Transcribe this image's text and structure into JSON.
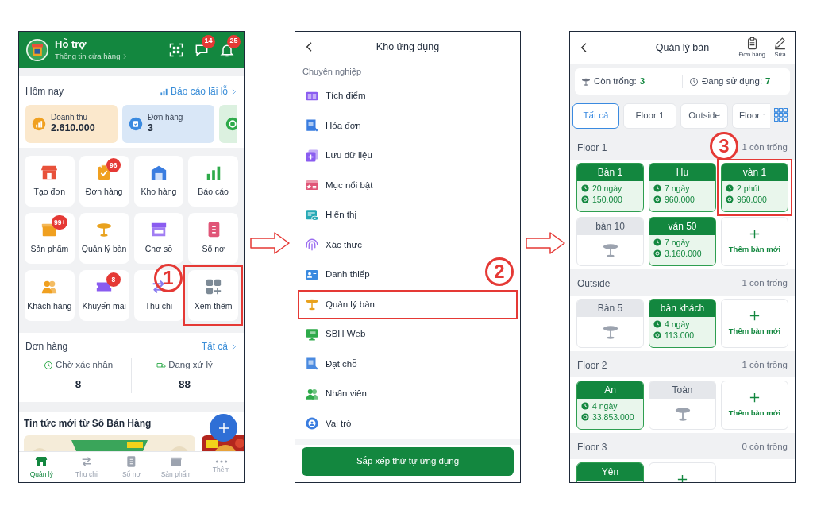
{
  "home": {
    "step": "1",
    "header": {
      "title": "Hỗ trợ",
      "subtitle": "Thông tin cửa hàng",
      "actions": [
        {
          "kind": "qr"
        },
        {
          "kind": "chat",
          "badge": "14"
        },
        {
          "kind": "bell",
          "badge": "25"
        }
      ]
    },
    "today": {
      "title": "Hôm nay",
      "link": "Báo cáo lãi lỗ",
      "cards": [
        {
          "kind": "revenue",
          "label": "Doanh thu",
          "value": "2.610.000"
        },
        {
          "kind": "orders",
          "label": "Đơn hàng",
          "value": "3"
        },
        {
          "kind": "cash"
        }
      ]
    },
    "tiles": [
      {
        "kind": "create",
        "label": "Tạo đơn",
        "highlighted": false
      },
      {
        "kind": "orders",
        "label": "Đơn hàng",
        "badge": "96",
        "highlighted": false
      },
      {
        "kind": "warehouse",
        "label": "Kho hàng",
        "highlighted": false
      },
      {
        "kind": "report",
        "label": "Báo cáo",
        "highlighted": false
      },
      {
        "kind": "product",
        "label": "Sản phẩm",
        "badge": "99+",
        "highlighted": false
      },
      {
        "kind": "table",
        "label": "Quản lý bàn",
        "highlighted": false
      },
      {
        "kind": "market",
        "label": "Chợ số",
        "highlighted": false
      },
      {
        "kind": "debt",
        "label": "Sổ nợ",
        "highlighted": false
      },
      {
        "kind": "customer",
        "label": "Khách hàng",
        "highlighted": false
      },
      {
        "kind": "promo",
        "label": "Khuyến mãi",
        "badge": "8",
        "highlighted": false
      },
      {
        "kind": "cashflow",
        "label": "Thu chi",
        "highlighted": false
      },
      {
        "kind": "more",
        "label": "Xem thêm",
        "highlighted": true
      }
    ],
    "orders": {
      "title": "Đơn hàng",
      "link": "Tất cả",
      "stats": [
        {
          "kind": "pending",
          "label": "Chờ xác nhận",
          "value": "8"
        },
        {
          "kind": "processing",
          "label": "Đang xử lý",
          "value": "88"
        }
      ]
    },
    "news": {
      "title": "Tin tức mới từ Số Bán Hàng"
    },
    "nav": [
      {
        "kind": "home",
        "label": "Quản lý",
        "selected": true
      },
      {
        "kind": "cashflow",
        "label": "Thu chi",
        "selected": false
      },
      {
        "kind": "debt",
        "label": "Sổ nợ",
        "selected": false
      },
      {
        "kind": "product",
        "label": "Sản phẩm",
        "selected": false
      },
      {
        "kind": "more",
        "label": "Thêm",
        "selected": false
      }
    ]
  },
  "app_store": {
    "step": "2",
    "title": "Kho ứng dụng",
    "section": "Chuyên nghiệp",
    "items": [
      {
        "kind": "points",
        "label": "Tích điểm",
        "highlighted": false
      },
      {
        "kind": "invoice",
        "label": "Hóa đơn",
        "highlighted": false
      },
      {
        "kind": "backup",
        "label": "Lưu dữ liệu",
        "highlighted": false
      },
      {
        "kind": "featured",
        "label": "Mục nổi bật",
        "highlighted": false
      },
      {
        "kind": "display",
        "label": "Hiển thị",
        "highlighted": false
      },
      {
        "kind": "auth",
        "label": "Xác thực",
        "highlighted": false
      },
      {
        "kind": "card",
        "label": "Danh thiếp",
        "highlighted": false
      },
      {
        "kind": "table",
        "label": "Quản lý bàn",
        "highlighted": true
      },
      {
        "kind": "web",
        "label": "SBH Web",
        "highlighted": false
      },
      {
        "kind": "booking",
        "label": "Đặt chỗ",
        "highlighted": false
      },
      {
        "kind": "staff",
        "label": "Nhân viên",
        "highlighted": false
      },
      {
        "kind": "role",
        "label": "Vai trò",
        "highlighted": false
      }
    ],
    "button": "Sắp xếp thứ tự ứng dụng"
  },
  "table_manager": {
    "step": "3",
    "title": "Quản lý bàn",
    "actions": [
      {
        "kind": "orders",
        "label": "Đơn hàng"
      },
      {
        "kind": "edit",
        "label": "Sửa"
      }
    ],
    "summary": [
      {
        "kind": "free",
        "label": "Còn trống:",
        "value": "3"
      },
      {
        "kind": "busy",
        "label": "Đang sử dụng:",
        "value": "7"
      }
    ],
    "filters": [
      {
        "label": "Tất cả",
        "selected": true
      },
      {
        "label": "Floor 1",
        "selected": false
      },
      {
        "label": "Outside",
        "selected": false
      },
      {
        "label": "Floor :",
        "selected": false
      }
    ],
    "areas": [
      {
        "name": "Floor 1",
        "free": "1 còn trống",
        "tables": [
          {
            "kind": "occupied",
            "name": "Bàn 1",
            "time": "20 ngày",
            "amount": "150.000",
            "highlighted": false
          },
          {
            "kind": "occupied",
            "name": "Hu",
            "time": "7 ngày",
            "amount": "960.000",
            "highlighted": false
          },
          {
            "kind": "occupied",
            "name": "vàn 1",
            "time": "2 phút",
            "amount": "960.000",
            "highlighted": true
          },
          {
            "kind": "empty",
            "name": "bàn 10",
            "highlighted": false
          },
          {
            "kind": "occupied",
            "name": "ván 50",
            "time": "7 ngày",
            "amount": "3.160.000",
            "highlighted": false
          },
          {
            "kind": "add",
            "label": "Thêm bàn mới",
            "highlighted": false
          }
        ]
      },
      {
        "name": "Outside",
        "free": "1 còn trống",
        "tables": [
          {
            "kind": "empty",
            "name": "Bàn 5",
            "highlighted": false
          },
          {
            "kind": "occupied",
            "name": "bàn khách",
            "time": "4 ngày",
            "amount": "113.000",
            "highlighted": false
          },
          {
            "kind": "add",
            "label": "Thêm bàn mới",
            "highlighted": false
          }
        ]
      },
      {
        "name": "Floor 2",
        "free": "1 còn trống",
        "tables": [
          {
            "kind": "occupied",
            "name": "An",
            "time": "4 ngày",
            "amount": "33.853.000",
            "highlighted": false
          },
          {
            "kind": "empty",
            "name": "Toàn",
            "highlighted": false
          },
          {
            "kind": "add",
            "label": "Thêm bàn mới",
            "highlighted": false
          }
        ]
      },
      {
        "name": "Floor 3",
        "free": "0 còn trống",
        "tables": [
          {
            "kind": "occupied",
            "name": "Yên",
            "highlighted": false
          },
          {
            "kind": "add",
            "highlighted": false
          }
        ]
      }
    ]
  }
}
